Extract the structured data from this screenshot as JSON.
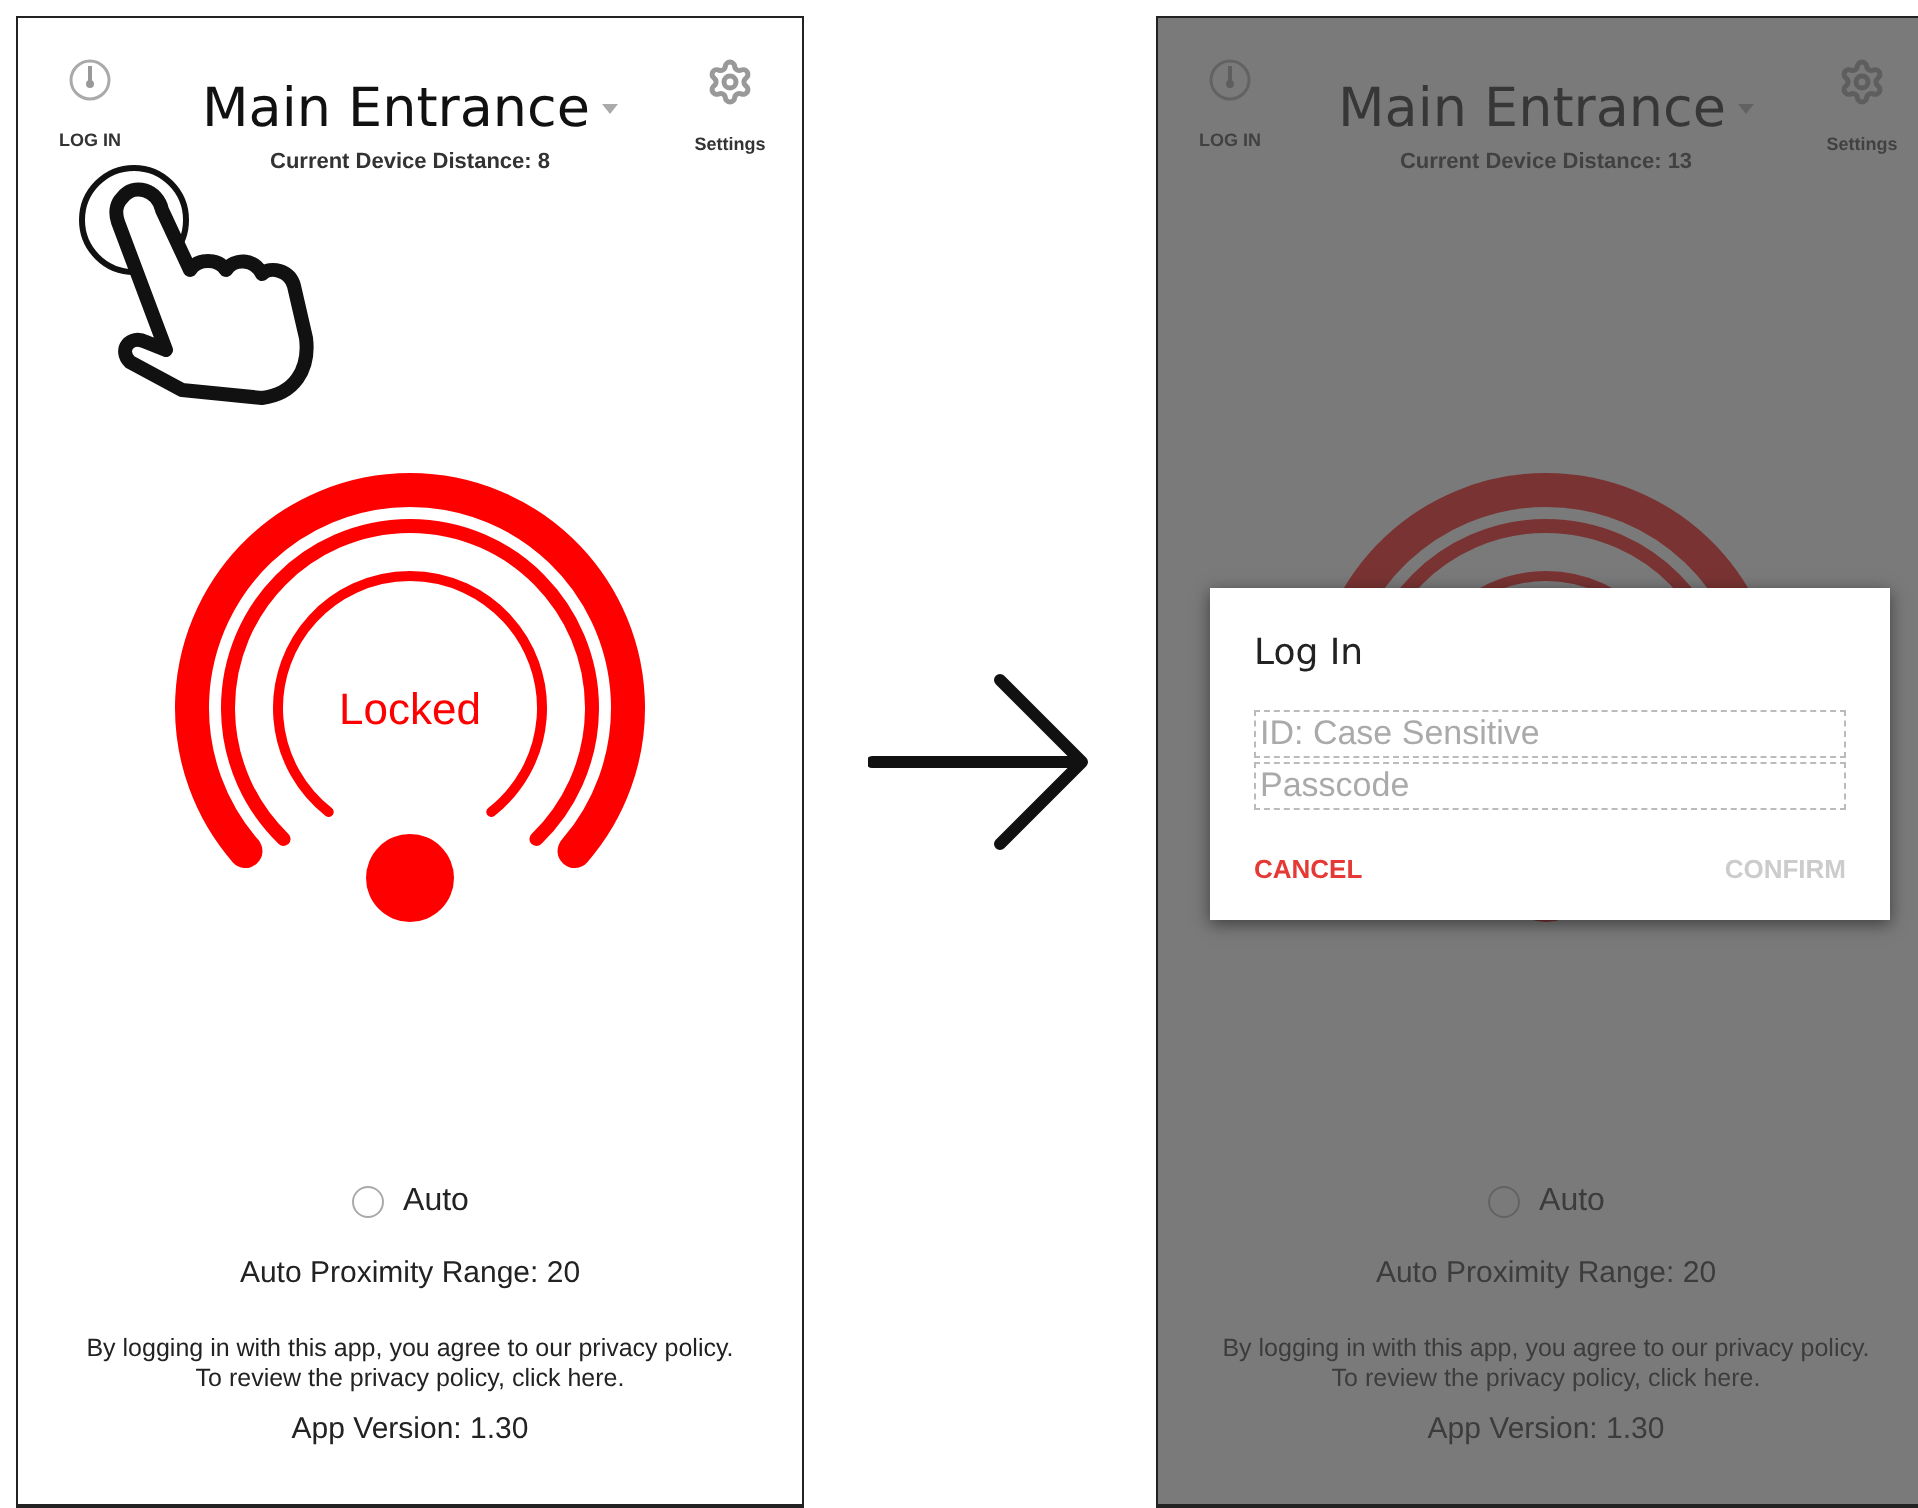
{
  "screens": [
    {
      "login_label": "LOG IN",
      "title": "Main Entrance",
      "settings_label": "Settings",
      "distance": "Current Device Distance: 8",
      "lock_status": "Locked",
      "auto": {
        "label": "Auto",
        "checked": false
      },
      "range": "Auto Proximity Range: 20",
      "privacy_lines": [
        "By logging in with this app, you agree to our privacy policy.",
        "To review the privacy policy, click here."
      ],
      "version": "App Version: 1.30",
      "tap_hint": true
    },
    {
      "login_label": "LOG IN",
      "title": "Main Entrance",
      "settings_label": "Settings",
      "distance": "Current Device Distance: 13",
      "auto": {
        "label": "Auto",
        "checked": false
      },
      "range": "Auto Proximity Range: 20",
      "privacy_lines": [
        "By logging in with this app, you agree to our privacy policy.",
        "To review the privacy policy, click here."
      ],
      "version": "App Version: 1.30",
      "dimmed": true,
      "dialog": {
        "title": "Log In",
        "fields": [
          {
            "placeholder": "ID: Case Sensitive"
          },
          {
            "placeholder": "Passcode"
          }
        ],
        "cancel": {
          "label": "CANCEL",
          "disabled": false
        },
        "confirm": {
          "label": "CONFIRM",
          "disabled": true
        }
      }
    }
  ]
}
